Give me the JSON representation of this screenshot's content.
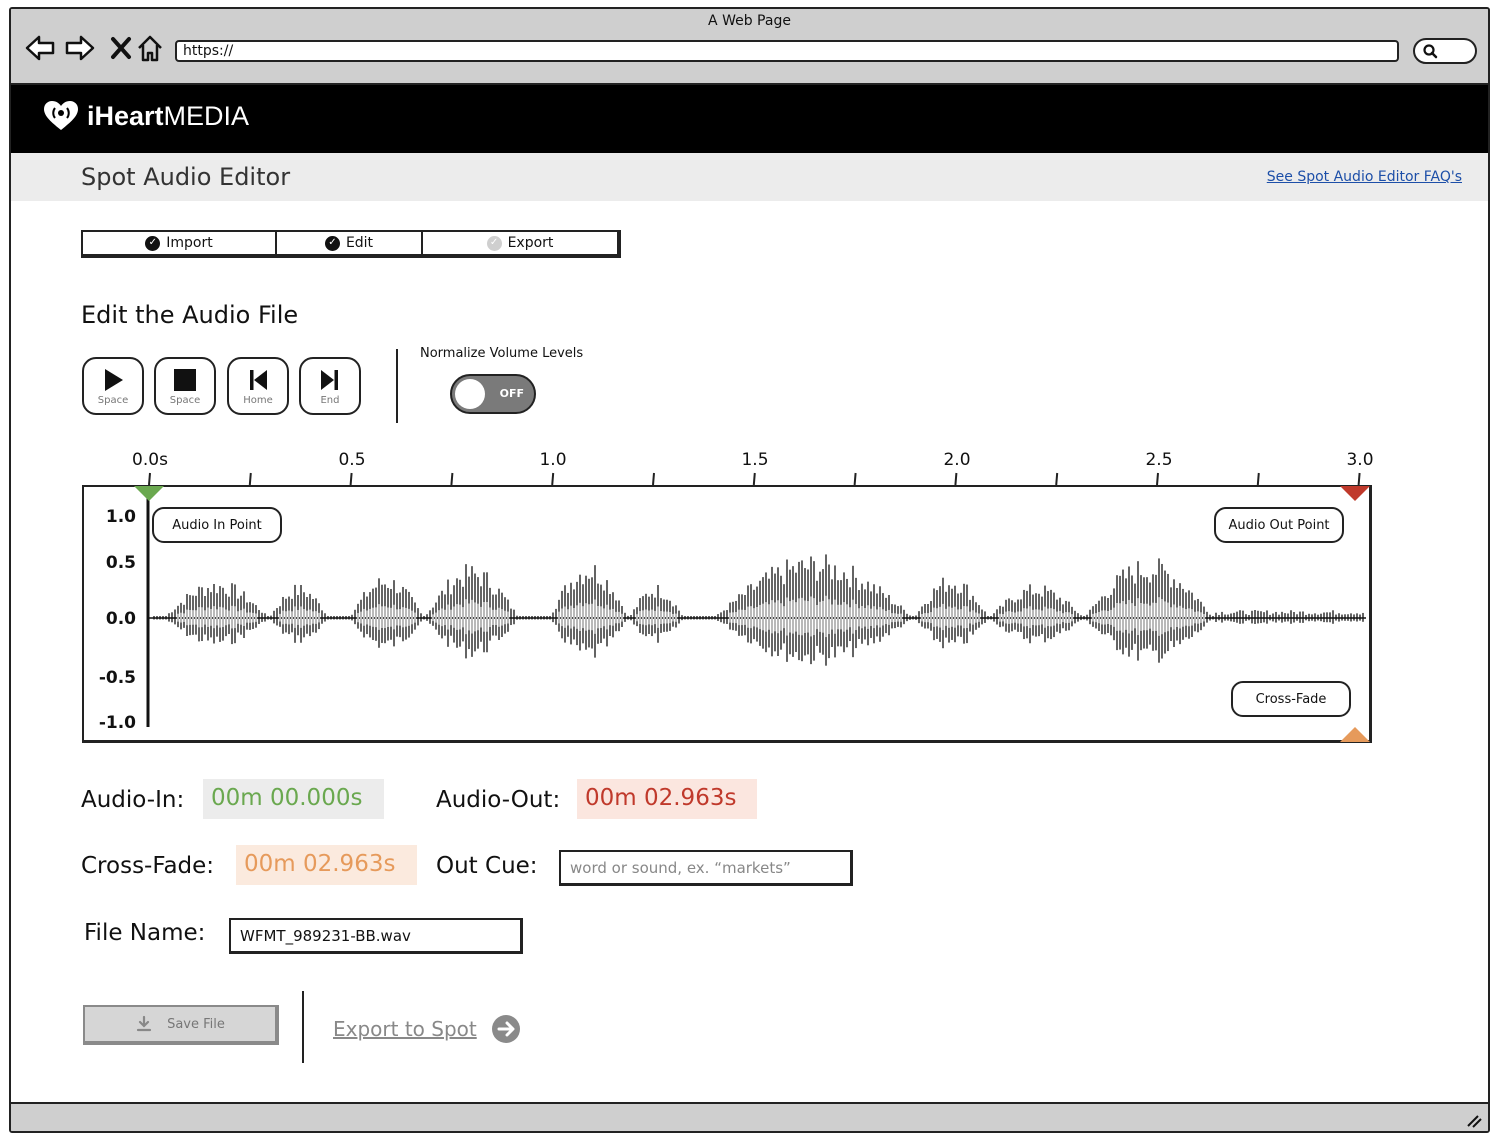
{
  "window": {
    "title": "A Web Page"
  },
  "browser": {
    "url": "https://"
  },
  "brand": {
    "logo_bold": "iHeart",
    "logo_light": "MEDIA"
  },
  "header": {
    "title": "Spot Audio Editor",
    "faq_link": "See Spot Audio Editor FAQ's"
  },
  "stepper": {
    "steps": [
      {
        "label": "Import",
        "state": "complete"
      },
      {
        "label": "Edit",
        "state": "complete"
      },
      {
        "label": "Export",
        "state": "pending"
      }
    ]
  },
  "editor": {
    "title": "Edit the Audio File",
    "transport": [
      {
        "icon": "play-icon",
        "hint": "Space"
      },
      {
        "icon": "stop-icon",
        "hint": "Space"
      },
      {
        "icon": "skip-start-icon",
        "hint": "Home"
      },
      {
        "icon": "skip-end-icon",
        "hint": "End"
      }
    ],
    "normalize": {
      "label": "Normalize Volume Levels",
      "state": "OFF"
    }
  },
  "timeline": {
    "ticks": [
      "0.0s",
      "0.5",
      "1.0",
      "1.5",
      "2.0",
      "2.5",
      "3.0"
    ],
    "y_ticks": [
      "1.0",
      "0.5",
      "0.0",
      "-0.5",
      "-1.0"
    ],
    "callouts": {
      "in_point": "Audio In Point",
      "out_point": "Audio Out Point",
      "cross_fade": "Cross-Fade"
    },
    "colors": {
      "in": "#6aa84f",
      "out": "#c0392b",
      "cross_fade": "#e69a5b"
    }
  },
  "fields": {
    "audio_in": {
      "label": "Audio-In:",
      "value": "00m 00.000s"
    },
    "audio_out": {
      "label": "Audio-Out:",
      "value": "00m 02.963s"
    },
    "cross_fade": {
      "label": "Cross-Fade:",
      "value": "00m 02.963s"
    },
    "out_cue": {
      "label": "Out Cue:",
      "placeholder": "word or sound, ex. “markets”"
    },
    "file_name": {
      "label": "File Name:",
      "value": "WFMT_989231-BB.wav"
    }
  },
  "actions": {
    "save": "Save File",
    "export": "Export to Spot"
  }
}
